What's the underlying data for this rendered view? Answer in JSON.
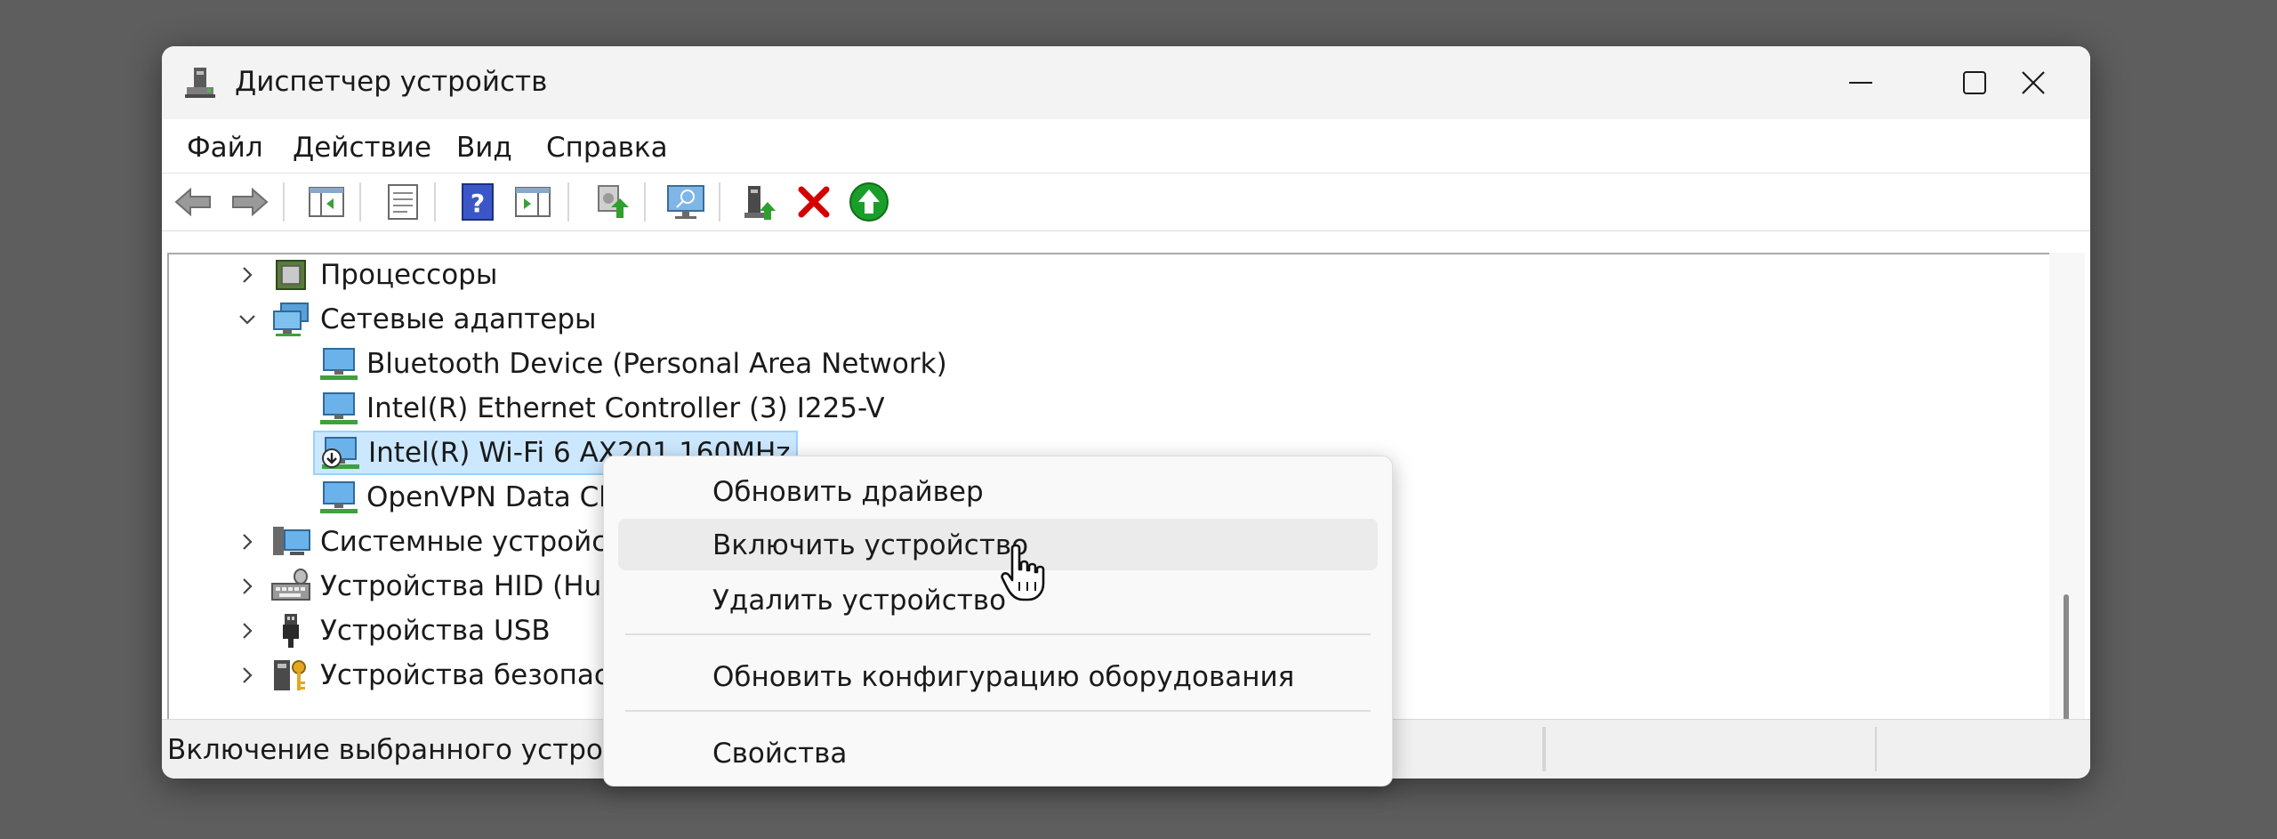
{
  "window": {
    "title": "Диспетчер устройств"
  },
  "menu": [
    "Файл",
    "Действие",
    "Вид",
    "Справка"
  ],
  "tree": {
    "rows": [
      {
        "label": "Процессоры",
        "expanded": false
      },
      {
        "label": "Сетевые адаптеры",
        "expanded": true
      },
      {
        "label": "Bluetooth Device (Personal Area Network)"
      },
      {
        "label": "Intel(R) Ethernet Controller (3) I225-V"
      },
      {
        "label": "Intel(R) Wi-Fi 6 AX201 160MHz",
        "selected": true,
        "disabled_icon": true
      },
      {
        "label": "OpenVPN Data Channel Offload"
      },
      {
        "label": "Системные устройства",
        "expanded": false
      },
      {
        "label": "Устройства HID (Human Interface Devices)",
        "expanded": false
      },
      {
        "label": "Устройства USB",
        "expanded": false
      },
      {
        "label": "Устройства безопасности",
        "expanded": false
      }
    ]
  },
  "context_menu": {
    "items": [
      {
        "label": "Обновить драйвер"
      },
      {
        "label": "Включить устройство",
        "hovered": true
      },
      {
        "label": "Удалить устройство"
      },
      {
        "label": "Обновить конфигурацию оборудования"
      },
      {
        "label": "Свойства"
      }
    ]
  },
  "status": {
    "text": "Включение выбранного устройства."
  },
  "colors": {
    "accent_selected": "#cce8ff",
    "delete_red": "#d40000",
    "update_green": "#1a9e2a"
  }
}
